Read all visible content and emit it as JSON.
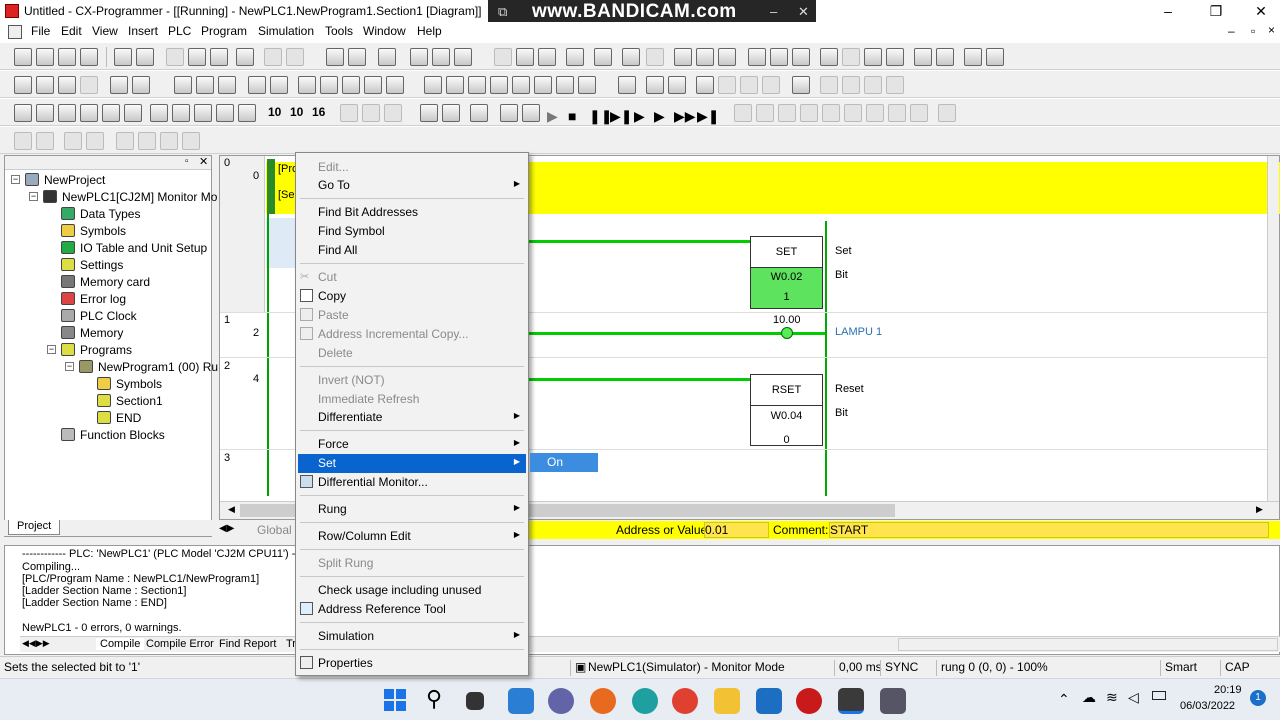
{
  "window": {
    "title": "Untitled - CX-Programmer - [[Running] - NewPLC1.NewProgram1.Section1 [Diagram]]",
    "minimize": "–",
    "maximize": "❐",
    "close": "✕",
    "child_minimize": "–",
    "child_restore": "▫",
    "child_close": "×"
  },
  "watermark": {
    "text": "www.BANDICAM.com",
    "brand_color": "#262626"
  },
  "menubar": {
    "items": [
      "File",
      "Edit",
      "View",
      "Insert",
      "PLC",
      "Program",
      "Simulation",
      "Tools",
      "Window",
      "Help"
    ]
  },
  "toolbar3": {
    "bits": [
      "10",
      "10",
      "16"
    ]
  },
  "project": {
    "root": "NewProject",
    "plc": "NewPLC1[CJ2M] Monitor Mo",
    "items": [
      "Data Types",
      "Symbols",
      "IO Table and Unit Setup",
      "Settings",
      "Memory card",
      "Error log",
      "PLC Clock",
      "Memory",
      "Programs"
    ],
    "program": "NewProgram1 (00) Ru",
    "program_items": [
      "Symbols",
      "Section1",
      "END"
    ],
    "function_blocks": "Function Blocks",
    "tab": "Project"
  },
  "ladder": {
    "rung0": {
      "num": "0",
      "step": "0",
      "comment_lines": [
        "[Pro",
        "[Se"
      ]
    },
    "rung1": {
      "num": "1",
      "step": "2"
    },
    "rung2": {
      "num": "2",
      "step": "4"
    },
    "rung3": {
      "num": "3"
    },
    "set_block": {
      "label": "SET",
      "operand": "W0.02",
      "value": "1",
      "name": "Set",
      "type": "Bit"
    },
    "timer_value": "10.00",
    "coil_name": "LAMPU 1",
    "rset_block": {
      "label": "RSET",
      "operand": "W0.04",
      "value": "0",
      "name": "Reset",
      "type": "Bit"
    },
    "highlight_color": "#ffff00",
    "energized_color": "#00c800"
  },
  "commentbar": {
    "global_label": "Global",
    "address_label": "Address or Value:",
    "address_value": "0.01",
    "comment_label": "Comment:",
    "comment_value": "START"
  },
  "output": {
    "header": "------------ PLC: 'NewPLC1' (PLC Model 'CJ2M CPU11') ----",
    "lines": [
      "Compiling...",
      "[PLC/Program Name : NewPLC1/NewProgram1]",
      "[Ladder Section Name : Section1]",
      "[Ladder Section Name : END]",
      "",
      "NewPLC1 - 0 errors, 0 warnings."
    ],
    "tabs": [
      "Compile",
      "Compile Error",
      "Find Report",
      "Tr"
    ]
  },
  "statusbar": {
    "message": "Sets the selected bit to '1'",
    "mode": "NewPLC1(Simulator) - Monitor Mode",
    "cycle": "0,00 ms",
    "sync": "SYNC",
    "position": "rung 0 (0, 0)  - 100%",
    "smart": "Smart",
    "caps": "CAP"
  },
  "taskbar": {
    "time": "20:19",
    "date": "06/03/2022",
    "notifications": "1"
  },
  "context_menu": {
    "items": [
      {
        "label": "Edit...",
        "disabled": true
      },
      {
        "label": "Go To",
        "submenu": true
      },
      {
        "label": "Find Bit Addresses"
      },
      {
        "label": "Find Symbol"
      },
      {
        "label": "Find All"
      },
      {
        "label": "Cut",
        "disabled": true
      },
      {
        "label": "Copy"
      },
      {
        "label": "Paste",
        "disabled": true
      },
      {
        "label": "Address Incremental Copy...",
        "disabled": true
      },
      {
        "label": "Delete",
        "disabled": true
      },
      {
        "label": "Invert (NOT)",
        "disabled": true
      },
      {
        "label": "Immediate Refresh",
        "disabled": true
      },
      {
        "label": "Differentiate",
        "submenu": true
      },
      {
        "label": "Force",
        "submenu": true
      },
      {
        "label": "Set",
        "submenu": true,
        "selected": true
      },
      {
        "label": "Differential Monitor..."
      },
      {
        "label": "Rung",
        "submenu": true
      },
      {
        "label": "Row/Column Edit",
        "submenu": true
      },
      {
        "label": "Split Rung",
        "disabled": true
      },
      {
        "label": "Check usage including unused"
      },
      {
        "label": "Address Reference Tool"
      },
      {
        "label": "Simulation",
        "submenu": true
      },
      {
        "label": "Properties"
      }
    ],
    "submenu_item": "On",
    "highlight_color": "#0a64d0"
  }
}
